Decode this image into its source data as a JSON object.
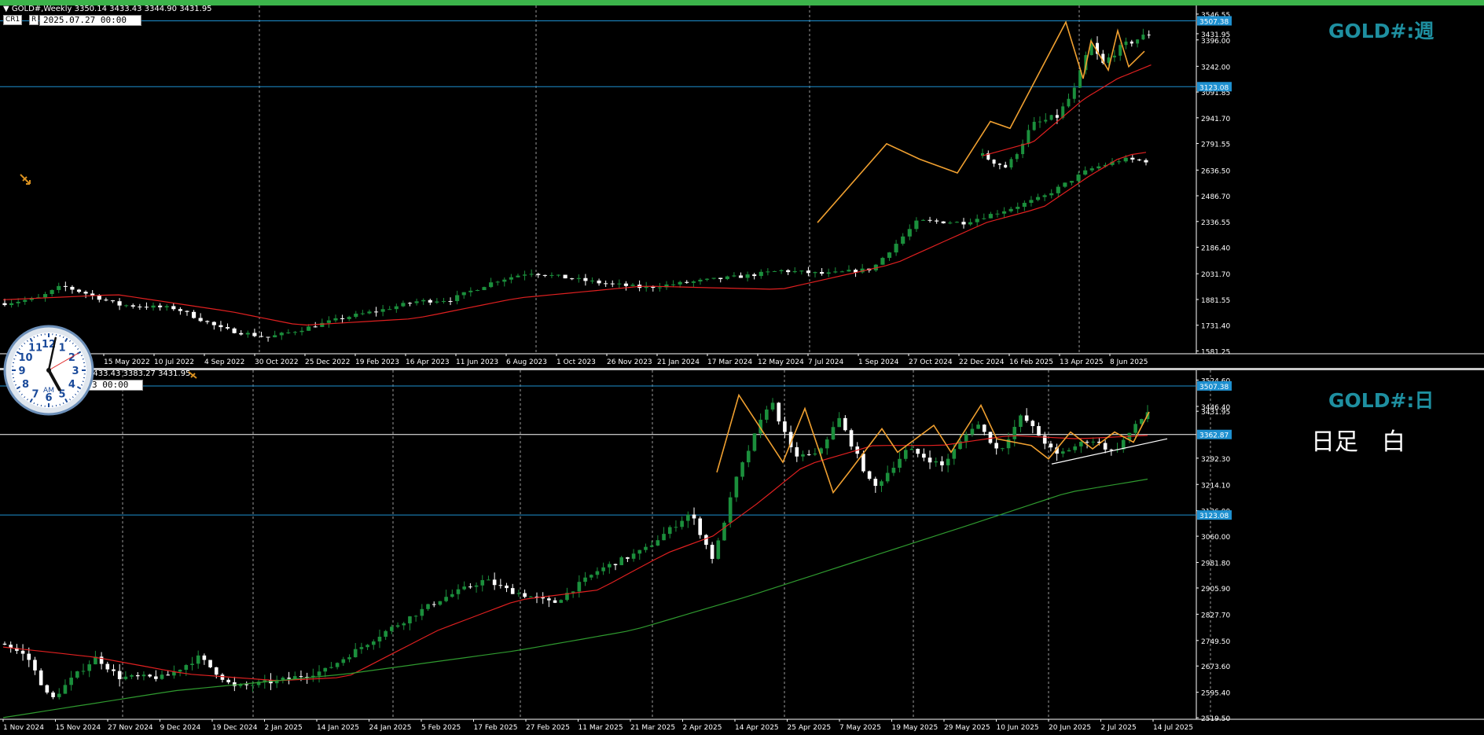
{
  "colors": {
    "background": "#000000",
    "bull": "#1b8f3c",
    "bear": "#ffffff",
    "ma_red": "#e02020",
    "ma_green": "#2f9a2f",
    "zigzag": "#f0a030",
    "hline": "#1e90d0",
    "symbol": "#1e8fa0",
    "status_bar": "#3cb44b"
  },
  "weekly": {
    "header": "GOLD#,Weekly  3350.14 3433.43 3344.90 3431.95",
    "tag_cr": "CR1",
    "tag_r": "R",
    "date_box": "2025.07.27 00:00",
    "symbol_label": "GOLD#:週",
    "price_labels": [
      {
        "text": "3546.55",
        "price": 3546.55,
        "highlight": false
      },
      {
        "text": "3431.95",
        "price": 3431.95,
        "highlight": false
      },
      {
        "text": "3396.00",
        "price": 3396.0,
        "highlight": false
      },
      {
        "text": "3242.00",
        "price": 3242.0,
        "highlight": false
      },
      {
        "text": "3091.85",
        "price": 3091.85,
        "highlight": false
      },
      {
        "text": "2941.70",
        "price": 2941.7,
        "highlight": false
      },
      {
        "text": "2791.55",
        "price": 2791.55,
        "highlight": false
      },
      {
        "text": "2636.50",
        "price": 2636.5,
        "highlight": false
      },
      {
        "text": "2486.70",
        "price": 2486.7,
        "highlight": false
      },
      {
        "text": "2336.55",
        "price": 2336.55,
        "highlight": false
      },
      {
        "text": "2186.40",
        "price": 2186.4,
        "highlight": false
      },
      {
        "text": "2031.70",
        "price": 2031.7,
        "highlight": false
      },
      {
        "text": "1881.55",
        "price": 1881.55,
        "highlight": false
      },
      {
        "text": "1731.40",
        "price": 1731.4,
        "highlight": false
      },
      {
        "text": "1581.25",
        "price": 1581.25,
        "highlight": false
      },
      {
        "text": "3507.38",
        "price": 3507.38,
        "highlight": true
      },
      {
        "text": "3123.08",
        "price": 3123.08,
        "highlight": true
      }
    ],
    "hlines": [
      3507.38,
      3123.08
    ],
    "date_labels": [
      "15 May 2022",
      "10 Jul 2022",
      "4 Sep 2022",
      "30 Oct 2022",
      "25 Dec 2022",
      "19 Feb 2023",
      "16 Apr 2023",
      "11 Jun 2023",
      "6 Aug 2023",
      "1 Oct 2023",
      "26 Nov 2023",
      "21 Jan 2024",
      "17 Mar 2024",
      "12 May 2024",
      "7 Jul 2024",
      "1 Sep 2024",
      "27 Oct 2024",
      "22 Dec 2024",
      "16 Feb 2025",
      "13 Apr 2025",
      "8 Jun 2025"
    ]
  },
  "daily": {
    "header": "3433.43 3383.27 3431.95",
    "date_box": "3 00:00",
    "symbol_label": "GOLD#:日",
    "note": "日足　白",
    "price_labels": [
      {
        "text": "3524.60",
        "price": 3524.6,
        "highlight": false
      },
      {
        "text": "3446.40",
        "price": 3446.4,
        "highlight": false
      },
      {
        "text": "3431.95",
        "price": 3431.95,
        "highlight": false
      },
      {
        "text": "3292.30",
        "price": 3292.3,
        "highlight": false
      },
      {
        "text": "3214.10",
        "price": 3214.1,
        "highlight": false
      },
      {
        "text": "3136.00",
        "price": 3136.0,
        "highlight": false
      },
      {
        "text": "3060.00",
        "price": 3060.0,
        "highlight": false
      },
      {
        "text": "2981.80",
        "price": 2981.8,
        "highlight": false
      },
      {
        "text": "2905.90",
        "price": 2905.9,
        "highlight": false
      },
      {
        "text": "2827.70",
        "price": 2827.7,
        "highlight": false
      },
      {
        "text": "2749.50",
        "price": 2749.5,
        "highlight": false
      },
      {
        "text": "2673.60",
        "price": 2673.6,
        "highlight": false
      },
      {
        "text": "2595.40",
        "price": 2595.4,
        "highlight": false
      },
      {
        "text": "2519.50",
        "price": 2519.5,
        "highlight": false
      },
      {
        "text": "3507.38",
        "price": 3507.38,
        "highlight": true
      },
      {
        "text": "3362.87",
        "price": 3362.87,
        "highlight": true
      },
      {
        "text": "3123.08",
        "price": 3123.08,
        "highlight": true
      }
    ],
    "hlines": [
      3507.38,
      3123.08
    ],
    "white_line": 3362.87,
    "date_labels": [
      "1 Nov 2024",
      "15 Nov 2024",
      "27 Nov 2024",
      "9 Dec 2024",
      "19 Dec 2024",
      "2 Jan 2025",
      "14 Jan 2025",
      "24 Jan 2025",
      "5 Feb 2025",
      "17 Feb 2025",
      "27 Feb 2025",
      "11 Mar 2025",
      "21 Mar 2025",
      "2 Apr 2025",
      "14 Apr 2025",
      "25 Apr 2025",
      "7 May 2025",
      "19 May 2025",
      "29 May 2025",
      "10 Jun 2025",
      "20 Jun 2025",
      "2 Jul 2025",
      "14 Jul 2025"
    ]
  },
  "clock": {
    "am_label": "AM",
    "numbers": [
      "12",
      "1",
      "2",
      "3",
      "4",
      "5",
      "6",
      "7",
      "8",
      "9",
      "10",
      "11"
    ],
    "hour": 5,
    "minute": 2,
    "second": 10
  }
}
